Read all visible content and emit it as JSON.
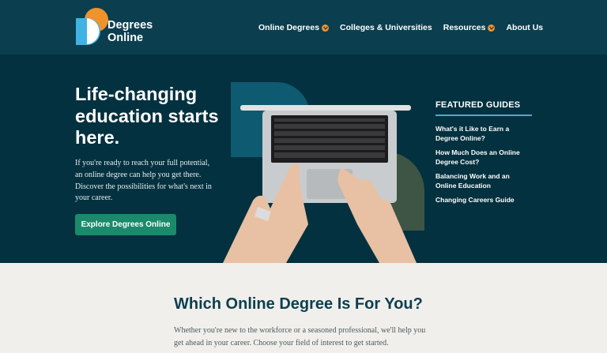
{
  "header": {
    "logo": {
      "line1": "Degrees",
      "line2": "Online"
    },
    "nav": [
      {
        "label": "Online Degrees",
        "has_dropdown": true
      },
      {
        "label": "Colleges & Universities",
        "has_dropdown": false
      },
      {
        "label": "Resources",
        "has_dropdown": true
      },
      {
        "label": "About Us",
        "has_dropdown": false
      }
    ]
  },
  "hero": {
    "title": "Life-changing education starts here.",
    "text": "If you're ready to reach your full potential, an online degree can help you get there. Discover the possibilities for what's next in your career.",
    "cta": "Explore Degrees Online",
    "illustration": "hands-typing-on-laptop"
  },
  "featured": {
    "heading": "FEATURED GUIDES",
    "links": [
      "What's it Like to Earn a Degree Online?",
      "How Much Does an Online Degree Cost?",
      "Balancing Work and an Online Education",
      "Changing Careers Guide"
    ]
  },
  "degree_section": {
    "title": "Which Online Degree Is For You?",
    "text": "Whether you're new to the workforce or a seasoned professional, we'll help you get ahead in your career. Choose your field of interest to get started."
  },
  "colors": {
    "header_bg": "#0b3f50",
    "hero_bg": "#03313f",
    "accent_orange": "#f0932b",
    "accent_blue": "#3fb3e4",
    "cta_green": "#1b8a6b",
    "section_bg": "#f1efeb"
  }
}
